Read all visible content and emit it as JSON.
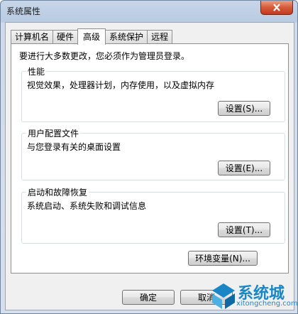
{
  "window": {
    "title": "系统属性"
  },
  "tabs": [
    {
      "label": "计算机名"
    },
    {
      "label": "硬件"
    },
    {
      "label": "高级"
    },
    {
      "label": "系统保护"
    },
    {
      "label": "远程"
    }
  ],
  "panel": {
    "intro": "要进行大多数更改，您必须作为管理员登录。",
    "performance": {
      "title": "性能",
      "desc": "视觉效果，处理器计划，内存使用，以及虚拟内存",
      "button": "设置(S)..."
    },
    "profiles": {
      "title": "用户配置文件",
      "desc": "与您登录有关的桌面设置",
      "button": "设置(E)..."
    },
    "startup": {
      "title": "启动和故障恢复",
      "desc": "系统启动、系统失败和调试信息",
      "button": "设置(T)..."
    },
    "env_button": "环境变量(N)..."
  },
  "footer": {
    "ok": "确定",
    "cancel": "取消"
  },
  "watermark": {
    "text": "系统城",
    "url": "xitongcheng.com"
  },
  "colors": {
    "accent": "#1a86c6",
    "close": "#c4391a"
  }
}
